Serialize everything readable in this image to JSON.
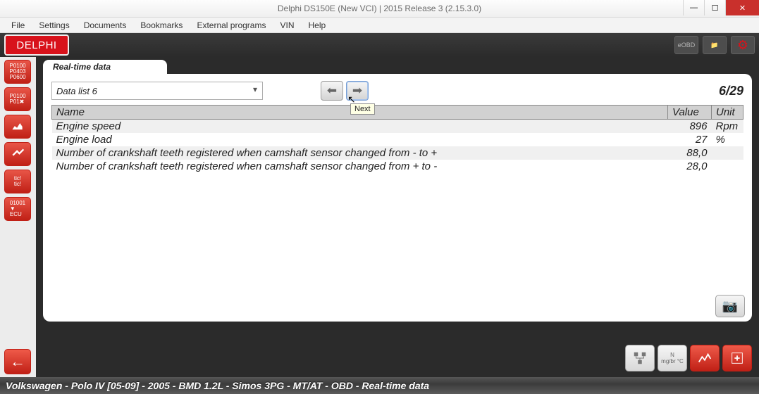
{
  "window": {
    "title": "Delphi DS150E (New VCI) | 2015 Release 3 (2.15.3.0)"
  },
  "menubar": [
    "File",
    "Settings",
    "Documents",
    "Bookmarks",
    "External programs",
    "VIN",
    "Help"
  ],
  "brand": {
    "logo": "DELPHI",
    "eobd": "eOBD"
  },
  "tab": {
    "title": "Real-time data"
  },
  "datalist": {
    "selected": "Data list 6",
    "page": "6/29",
    "tooltip": "Next"
  },
  "chart_data": {
    "type": "table",
    "columns": [
      "Name",
      "Value",
      "Unit"
    ],
    "rows": [
      {
        "name": "Engine speed",
        "value": "896",
        "unit": "Rpm"
      },
      {
        "name": "Engine load",
        "value": "27",
        "unit": "%"
      },
      {
        "name": "Number of crankshaft teeth registered when camshaft sensor changed from - to +",
        "value": "88,0",
        "unit": ""
      },
      {
        "name": "Number of crankshaft teeth registered when camshaft sensor changed from + to -",
        "value": "28,0",
        "unit": ""
      }
    ]
  },
  "status": "Volkswagen - Polo IV [05-09] - 2005 - BMD 1.2L - Simos 3PG - MT/AT - OBD - Real-time data"
}
